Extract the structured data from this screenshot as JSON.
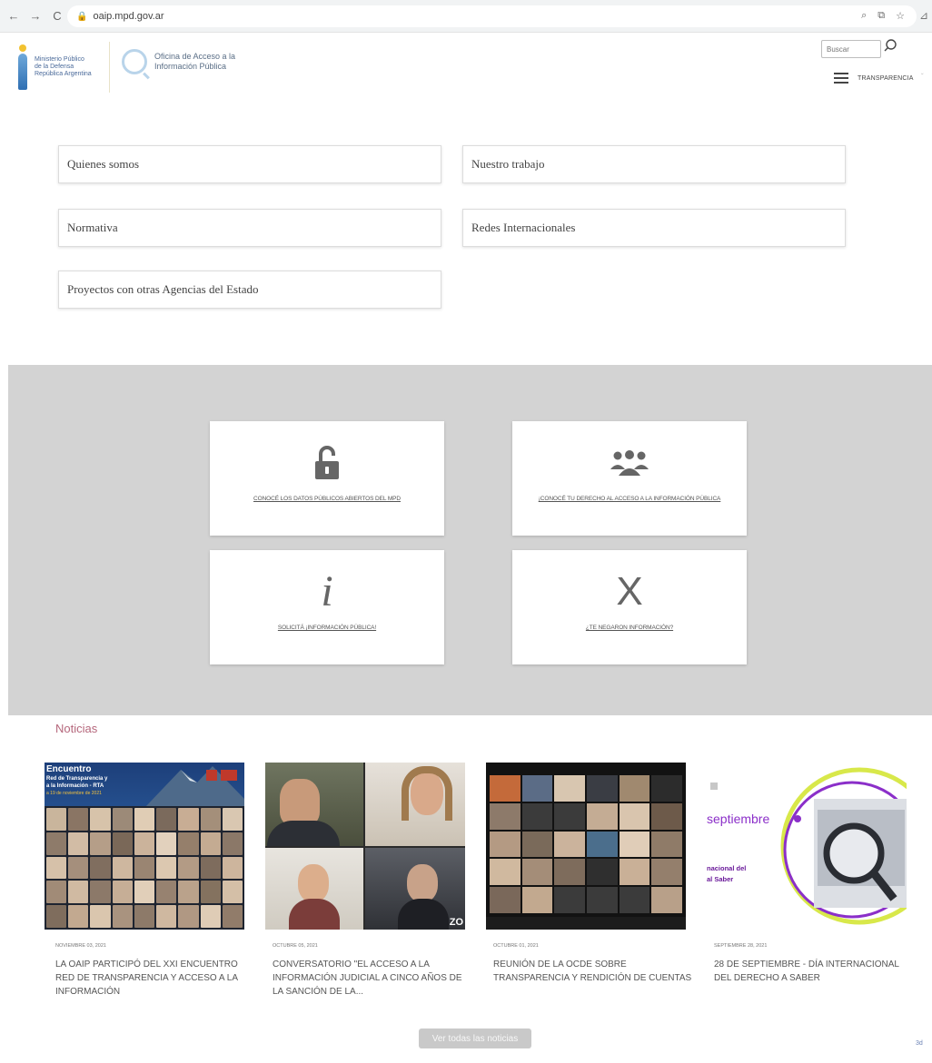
{
  "browser": {
    "back": "←",
    "forward": "→",
    "reload": "C",
    "lock": "🔒",
    "url": "oaip.mpd.gov.ar",
    "right_icons": [
      "⌕",
      "⧉",
      "☆"
    ],
    "ext": "⊿"
  },
  "header": {
    "mpd_logo_lines": [
      "Ministerio Público",
      "de la Defensa",
      "República Argentina"
    ],
    "oaip_lines": [
      "Oficina de Acceso a la",
      "Información Pública"
    ],
    "search_placeholder": "Buscar",
    "transparency_label": "TRANSPARENCIA",
    "caret": "ˇ"
  },
  "menu": [
    "Quienes somos",
    "Nuestro trabajo",
    "Normativa",
    "Redes Internacionales",
    "Proyectos con otras Agencias del Estado"
  ],
  "cards": [
    {
      "label": "CONOCÉ LOS DATOS PÚBLICOS ABIERTOS DEL MPD",
      "icon": "lock-open-icon"
    },
    {
      "label": "¡CONOCÉ TU DERECHO AL ACCESO A LA INFORMACIÓN PÚBLICA",
      "icon": "people-icon"
    },
    {
      "label": "SOLICITÁ ¡INFORMACIÓN PÚBLICA!",
      "icon": "info-icon",
      "glyph": "i"
    },
    {
      "label": "¿TE NEGARON INFORMACIÓN?",
      "icon": "x-icon",
      "glyph": "X"
    }
  ],
  "news": {
    "title": "Noticias",
    "items": [
      {
        "date": "NOVIEMBRE 03, 2021",
        "headline": "LA OAIP PARTICIPÓ DEL XXI ENCUENTRO RED DE TRANSPARENCIA Y ACCESO A LA INFORMACIÓN",
        "image_text": [
          "Encuentro",
          "Red de Transparencia y",
          "a la Información - RTA",
          "a 19 de noviembre de 2021"
        ]
      },
      {
        "date": "OCTUBRE 05, 2021",
        "headline": "CONVERSATORIO \"EL ACCESO A LA INFORMACIÓN JUDICIAL A CINCO AÑOS DE LA SANCIÓN DE LA...",
        "image_text": [
          "ZO"
        ]
      },
      {
        "date": "OCTUBRE 01, 2021",
        "headline": "REUNIÓN DE LA OCDE SOBRE TRANSPARENCIA Y RENDICIÓN DE CUENTAS",
        "image_text": []
      },
      {
        "date": "SEPTIEMBRE 28, 2021",
        "headline": "28 DE SEPTIEMBRE - DÍA INTERNACIONAL DEL DERECHO A SABER",
        "image_text": [
          "septiembre",
          "nacional del",
          "al Saber"
        ]
      }
    ],
    "all_button": "Ver todas las noticias"
  },
  "corner_mark": "3d"
}
